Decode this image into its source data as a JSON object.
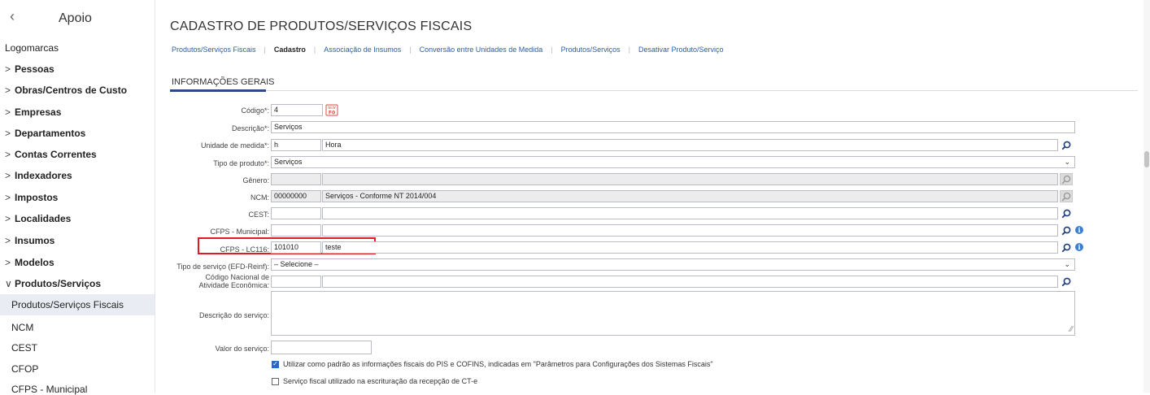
{
  "sidebar": {
    "title": "Apoio",
    "back_icon": "chevron-left-icon",
    "items": [
      {
        "label": "Logomarcas",
        "type": "plain"
      },
      {
        "label": "Pessoas",
        "type": "collapsed"
      },
      {
        "label": "Obras/Centros de Custo",
        "type": "collapsed"
      },
      {
        "label": "Empresas",
        "type": "collapsed"
      },
      {
        "label": "Departamentos",
        "type": "collapsed"
      },
      {
        "label": "Contas Correntes",
        "type": "collapsed"
      },
      {
        "label": "Indexadores",
        "type": "collapsed"
      },
      {
        "label": "Impostos",
        "type": "collapsed"
      },
      {
        "label": "Localidades",
        "type": "collapsed"
      },
      {
        "label": "Insumos",
        "type": "collapsed"
      },
      {
        "label": "Modelos",
        "type": "collapsed"
      },
      {
        "label": "Produtos/Serviços",
        "type": "expanded"
      },
      {
        "label": "Produtos/Serviços Fiscais",
        "type": "active"
      },
      {
        "label": "NCM",
        "type": "sub"
      },
      {
        "label": "CEST",
        "type": "sub"
      },
      {
        "label": "CFOP",
        "type": "sub"
      },
      {
        "label": "CFPS - Municipal",
        "type": "sub"
      }
    ]
  },
  "page": {
    "title": "CADASTRO DE PRODUTOS/SERVIÇOS FISCAIS",
    "tabs": [
      {
        "label": "Produtos/Serviços Fiscais",
        "current": false
      },
      {
        "label": "Cadastro",
        "current": true
      },
      {
        "label": "Associação de Insumos",
        "current": false
      },
      {
        "label": "Conversão entre Unidades de Medida",
        "current": false
      },
      {
        "label": "Produtos/Serviços",
        "current": false
      },
      {
        "label": "Desativar Produto/Serviço",
        "current": false
      }
    ],
    "section_title": "INFORMAÇÕES GERAIS"
  },
  "form": {
    "codigo": {
      "label": "Código*:",
      "value": "4"
    },
    "descricao": {
      "label": "Descrição*:",
      "value": "Serviços"
    },
    "unidade": {
      "label": "Unidade de medida*:",
      "code": "h",
      "name": "Hora"
    },
    "tipo_produto": {
      "label": "Tipo de produto*:",
      "value": "Serviços"
    },
    "genero": {
      "label": "Gênero:",
      "code": "",
      "name": ""
    },
    "ncm": {
      "label": "NCM:",
      "code": "00000000",
      "name": "Serviços - Conforme NT 2014/004"
    },
    "cest": {
      "label": "CEST:",
      "code": "",
      "name": ""
    },
    "cfps_municipal": {
      "label": "CFPS - Municipal:",
      "code": "",
      "name": ""
    },
    "cfps_lc116": {
      "label": "CFPS - LC116:",
      "code": "101010",
      "name": "teste"
    },
    "tipo_servico": {
      "label": "Tipo de serviço (EFD-Reinf):",
      "value": "– Selecione –"
    },
    "cnae": {
      "label_line1": "Código Nacional de",
      "label_line2": "Atividade Econômica:",
      "code": "",
      "name": ""
    },
    "descricao_servico": {
      "label": "Descrição do serviço:",
      "value": ""
    },
    "valor_servico": {
      "label": "Valor do serviço:",
      "value": ""
    },
    "checkbox_pis_cofins": {
      "label": "Utilizar como padrão as informações fiscais do PIS e COFINS, indicadas em \"Parâmetros para Configurações dos Sistemas Fiscais\"",
      "checked": true
    },
    "checkbox_cte": {
      "label": "Serviço fiscal utilizado na escrituração da recepção de CT-e",
      "checked": false
    }
  },
  "icons": {
    "search": "search-icon",
    "info": "info-icon",
    "new_code": "new-code-icon",
    "dropdown": "chevron-down-icon"
  },
  "colors": {
    "accent": "#2b4a86",
    "link": "#2b5ea8",
    "highlight": "#e21b23",
    "info": "#3a7fd1"
  }
}
